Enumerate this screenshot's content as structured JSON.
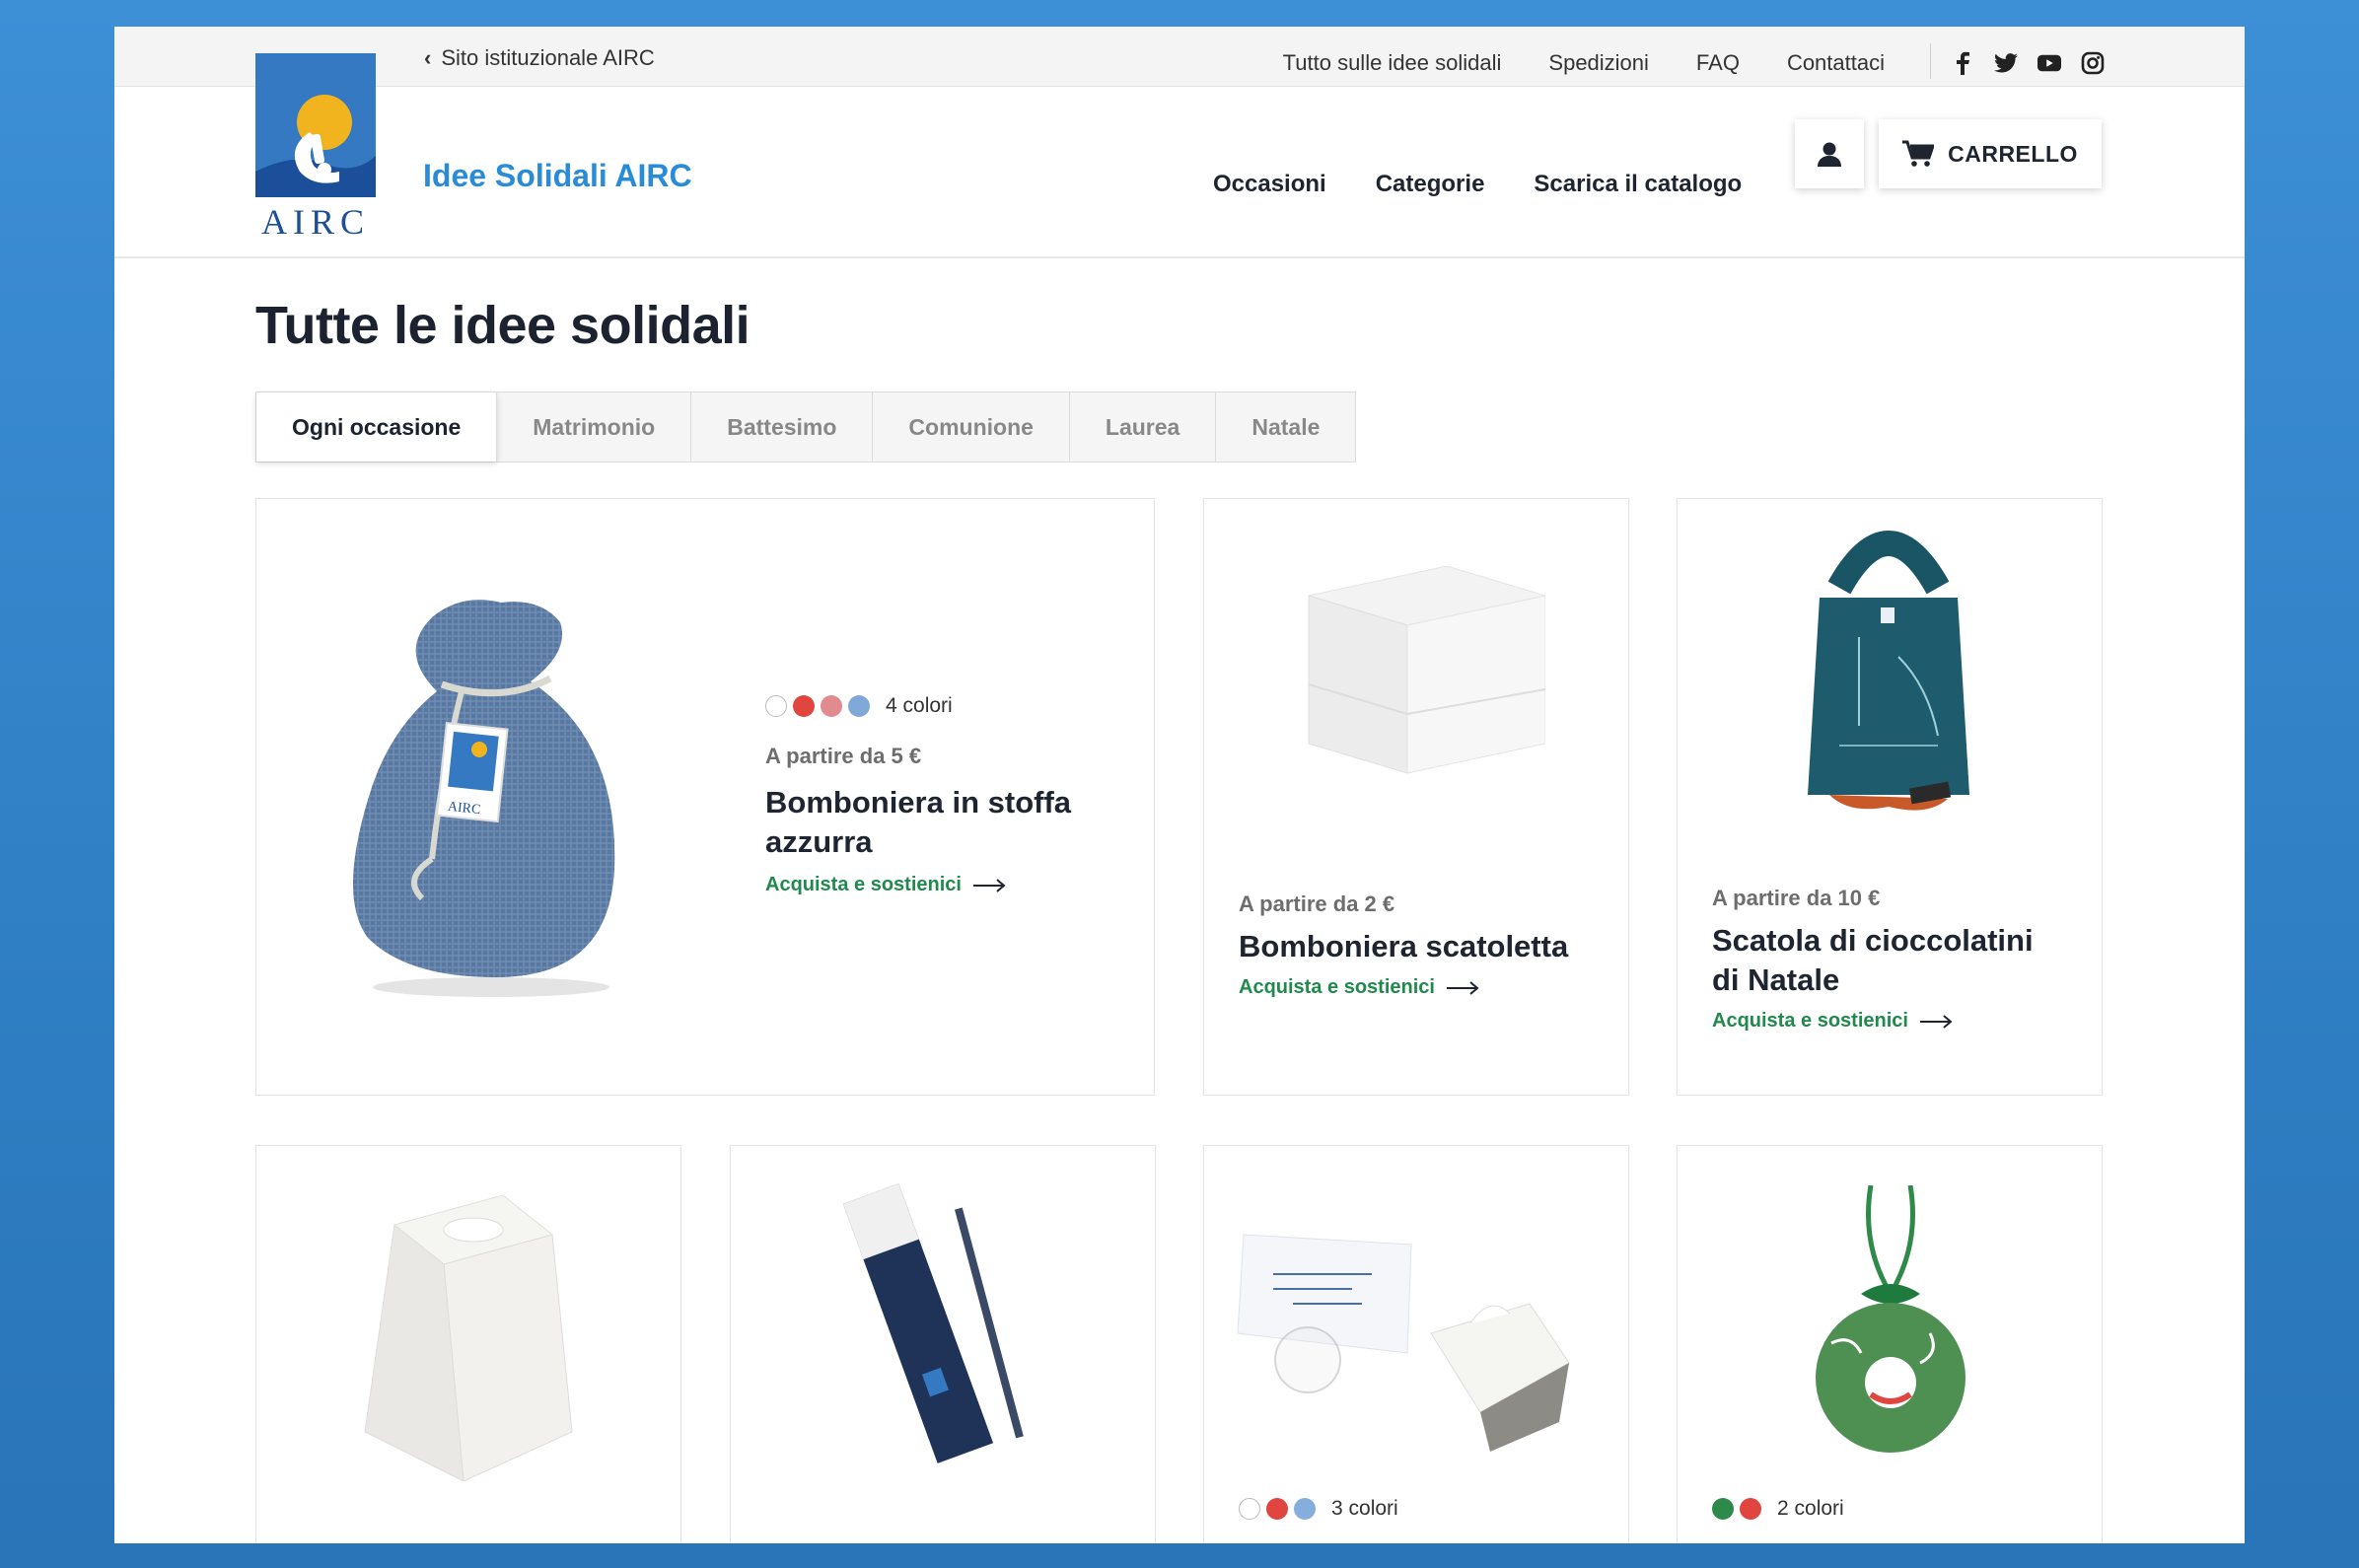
{
  "topbar": {
    "back_link": "Sito istituzionale AIRC",
    "links": [
      "Tutto sulle idee solidali",
      "Spedizioni",
      "FAQ",
      "Contattaci"
    ],
    "social_icons": [
      "facebook-icon",
      "twitter-icon",
      "youtube-icon",
      "instagram-icon"
    ]
  },
  "header": {
    "logo_text": "AIRC",
    "brand_title": "Idee Solidali AIRC",
    "nav": [
      "Occasioni",
      "Categorie",
      "Scarica il catalogo"
    ],
    "cart_label": "CARRELLO"
  },
  "page": {
    "title": "Tutte le idee solidali",
    "tabs": [
      "Ogni occasione",
      "Matrimonio",
      "Battesimo",
      "Comunione",
      "Laurea",
      "Natale"
    ],
    "active_tab": "Ogni occasione"
  },
  "products": [
    {
      "price": "A partire da 5 €",
      "name_line1": "Bomboniera in stoffa",
      "name_line2": "azzurra",
      "cta": "Acquista e sostienici",
      "swatches": [
        "#ffffff",
        "#e0463f",
        "#e28b8e",
        "#7ea9d8"
      ],
      "colors_label": "4 colori"
    },
    {
      "price": "A partire da 2 €",
      "name_line1": "Bomboniera scatoletta",
      "cta": "Acquista e sostienici"
    },
    {
      "price": "A partire da 10 €",
      "name_line1": "Scatola di cioccolatini",
      "name_line2": "di Natale",
      "cta": "Acquista e sostienici"
    },
    {
      "image": "white-handbag-box"
    },
    {
      "image": "blue-pen-case"
    },
    {
      "image": "card-and-white-box",
      "swatches": [
        "#ffffff",
        "#e0463f",
        "#86aedc"
      ],
      "colors_label": "3 colori"
    },
    {
      "image": "green-christmas-ornament",
      "swatches": [
        "#2d8a4a",
        "#e0463f"
      ],
      "colors_label": "2 colori"
    }
  ],
  "colors": {
    "accent_blue": "#2a8bd6",
    "cta_green": "#1f8a4c",
    "dark_text": "#1e2430"
  }
}
